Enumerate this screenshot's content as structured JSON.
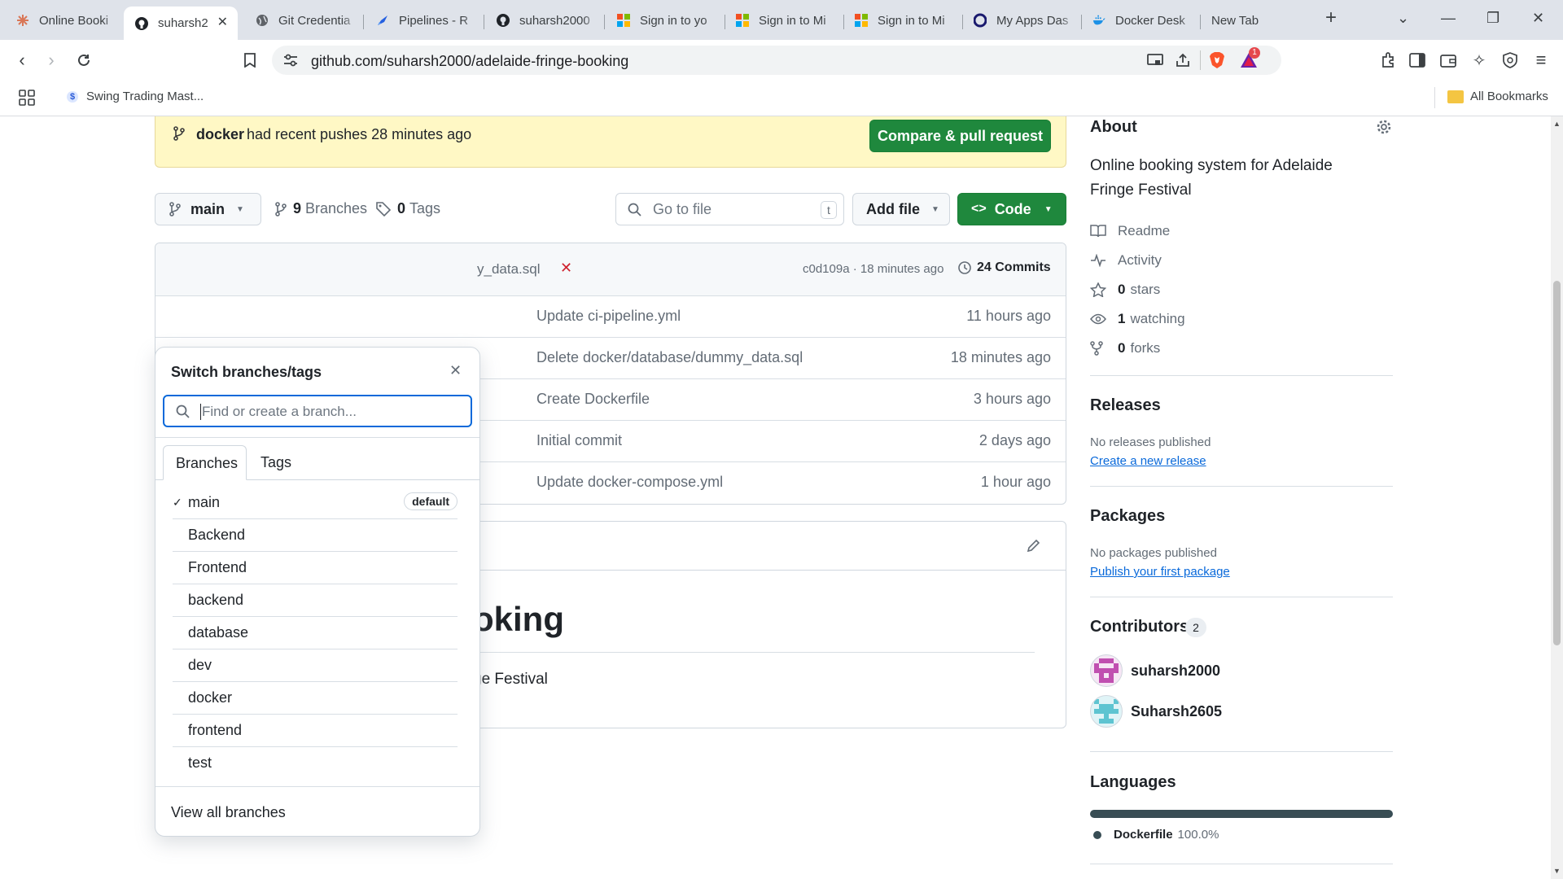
{
  "browser": {
    "tabs": [
      {
        "title": "Online Booki",
        "icon": "asterisk-icon"
      },
      {
        "title": "suharsh2",
        "icon": "github-icon"
      },
      {
        "title": "Git Credentia",
        "icon": "globe-icon"
      },
      {
        "title": "Pipelines - R",
        "icon": "azure-pipelines-icon"
      },
      {
        "title": "suharsh2000",
        "icon": "github-icon"
      },
      {
        "title": "Sign in to yo",
        "icon": "microsoft-icon"
      },
      {
        "title": "Sign in to Mi",
        "icon": "microsoft-icon"
      },
      {
        "title": "Sign in to Mi",
        "icon": "microsoft-icon"
      },
      {
        "title": "My Apps Das",
        "icon": "okta-icon"
      },
      {
        "title": "Docker Desk",
        "icon": "docker-icon"
      },
      {
        "title": "New Tab",
        "icon": ""
      }
    ],
    "url": "github.com/suharsh2000/adelaide-fringe-booking",
    "brave_badge": "1",
    "bookmark": "Swing Trading Mast...",
    "all_bookmarks": "All Bookmarks"
  },
  "banner": {
    "branch": "docker",
    "text": "had recent pushes 28 minutes ago",
    "button": "Compare & pull request"
  },
  "repo_bar": {
    "branch_button": "main",
    "branches_count": "9",
    "branches_label": "Branches",
    "tags_count": "0",
    "tags_label": "Tags",
    "goto_placeholder": "Go to file",
    "goto_shortcut": "t",
    "add_file": "Add file",
    "code": "Code"
  },
  "commit_header": {
    "file_fragment": "y_data.sql",
    "hash_time": "c0d109a · 18 minutes ago",
    "commits": "24 Commits"
  },
  "files": [
    {
      "message": "Update ci-pipeline.yml",
      "age": "11 hours ago"
    },
    {
      "message": "Delete docker/database/dummy_data.sql",
      "age": "18 minutes ago"
    },
    {
      "message": "Create Dockerfile",
      "age": "3 hours ago"
    },
    {
      "message": "Initial commit",
      "age": "2 days ago"
    },
    {
      "message": "Update docker-compose.yml",
      "age": "1 hour ago"
    }
  ],
  "readme": {
    "heading_fragment": "oking",
    "text_fragment": "ge Festival"
  },
  "dropdown": {
    "title": "Switch branches/tags",
    "placeholder": "Find or create a branch...",
    "tab_branches": "Branches",
    "tab_tags": "Tags",
    "default_label": "default",
    "branches": [
      "main",
      "Backend",
      "Frontend",
      "backend",
      "database",
      "dev",
      "docker",
      "frontend",
      "test"
    ],
    "view_all": "View all branches"
  },
  "about": {
    "heading": "About",
    "description": "Online booking system for Adelaide Fringe Festival",
    "readme": "Readme",
    "activity": "Activity",
    "stars_count": "0",
    "stars": "stars",
    "watching_count": "1",
    "watching": "watching",
    "forks_count": "0",
    "forks": "forks"
  },
  "releases": {
    "heading": "Releases",
    "empty": "No releases published",
    "link": "Create a new release"
  },
  "packages": {
    "heading": "Packages",
    "empty": "No packages published",
    "link": "Publish your first package"
  },
  "contributors": {
    "heading": "Contributors",
    "count": "2",
    "people": [
      "suharsh2000",
      "Suharsh2605"
    ]
  },
  "languages": {
    "heading": "Languages",
    "items": [
      {
        "name": "Dockerfile",
        "percent": "100.0%",
        "fraction": 1.0,
        "color": "#384d54"
      }
    ]
  },
  "colors": {
    "green": "#1f883d",
    "banner_bg": "#fff8c5",
    "link": "#0969da",
    "danger": "#cf222e"
  }
}
